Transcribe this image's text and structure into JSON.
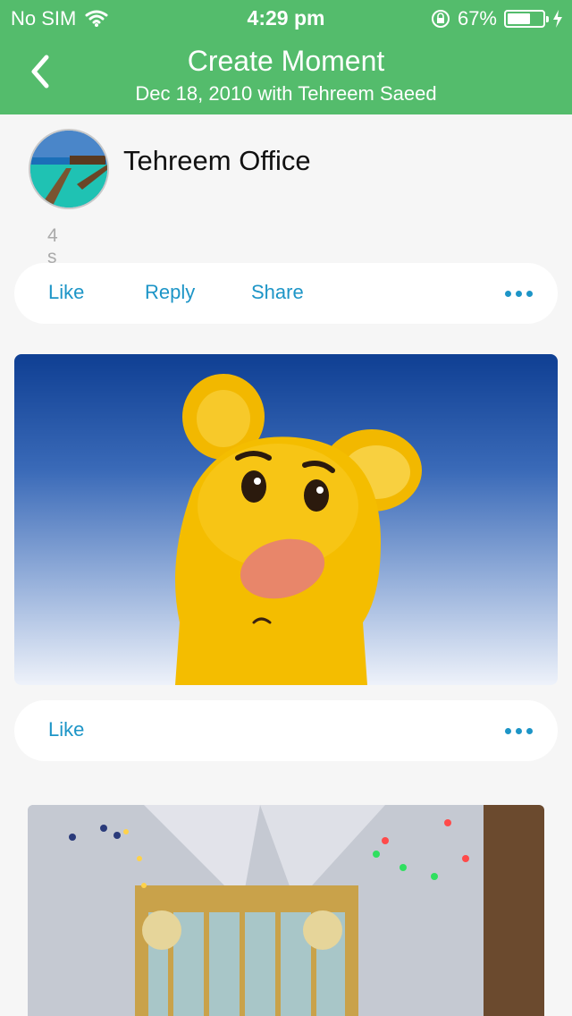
{
  "status_bar": {
    "carrier": "No SIM",
    "time": "4:29 pm",
    "battery": "67%",
    "battery_level": 0.67
  },
  "nav": {
    "title": "Create Moment",
    "subtitle": "Dec 18, 2010 with Tehreem Saeed"
  },
  "post": {
    "author": "Tehreem Office",
    "age": "4 s"
  },
  "actions": {
    "like": "Like",
    "reply": "Reply",
    "share": "Share"
  },
  "photo_actions": {
    "like": "Like"
  },
  "colors": {
    "header": "#54bc6c",
    "link": "#1d95c7"
  }
}
